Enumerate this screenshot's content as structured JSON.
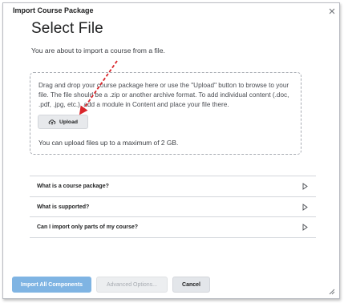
{
  "dialog": {
    "title": "Import Course Package"
  },
  "main": {
    "heading": "Select File",
    "intro": "You are about to import a course from a file.",
    "dropzone": {
      "instructions": "Drag and drop your course package here or use the \"Upload\" button to browse to your file. The file should be a .zip or another archive format. To add individual content (.doc, .pdf, .jpg, etc.), add a module in Content and place your file there.",
      "upload_label": "Upload",
      "limit": "You can upload files up to a maximum of 2 GB."
    },
    "accordion": [
      {
        "label": "What is a course package?"
      },
      {
        "label": "What is supported?"
      },
      {
        "label": "Can I import only parts of my course?"
      }
    ]
  },
  "footer": {
    "primary_label": "Import All Components",
    "advanced_label": "Advanced Options...",
    "cancel_label": "Cancel"
  },
  "colors": {
    "primary": "#7fb4e3",
    "annotation_arrow": "#d9262b"
  },
  "icons": [
    "close-icon",
    "upload-icon",
    "chevron-right-icon",
    "resize-handle-icon"
  ]
}
